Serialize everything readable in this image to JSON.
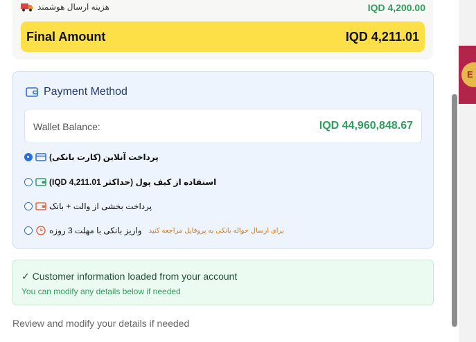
{
  "background_page": {
    "badge_text": "E"
  },
  "summary": {
    "shipping_label": "هزینه ارسال هوشمند",
    "shipping_amount": "IQD 4,200.00",
    "final_label": "Final Amount",
    "final_amount": "IQD 4,211.01"
  },
  "payment": {
    "title": "Payment Method",
    "wallet_balance_label": "Wallet Balance:",
    "wallet_balance_value": "IQD 44,960,848.67",
    "options": [
      {
        "label": "پرداخت آنلاین (کارت بانکی)",
        "icon": "credit-card-icon",
        "selected": true,
        "note": ""
      },
      {
        "label": "استفاده از کیف پول (حداکثر 4,211.01 IQD)",
        "icon": "wallet-icon",
        "selected": false,
        "note": ""
      },
      {
        "label": "پرداخت بخشی از والت + بانک",
        "icon": "wallet-bank-icon",
        "selected": false,
        "note": ""
      },
      {
        "label": "واریز بانکی با مهلت 3 روزه",
        "icon": "clock-icon",
        "selected": false,
        "note": "برای ارسال حواله بانکی به پروفایل مراجعه کنید"
      }
    ]
  },
  "customer_info": {
    "title": "✓ Customer information loaded from your account",
    "subtitle": "You can modify any details below if needed"
  },
  "review_text": "Review and modify your details if needed",
  "colors": {
    "final_bar": "#fde047",
    "amount_green": "#2e9e5e",
    "payment_bg": "#eef4fd",
    "info_bg": "#ecfbf2",
    "radio_blue": "#2b6fd6",
    "note_orange": "#d97706"
  }
}
